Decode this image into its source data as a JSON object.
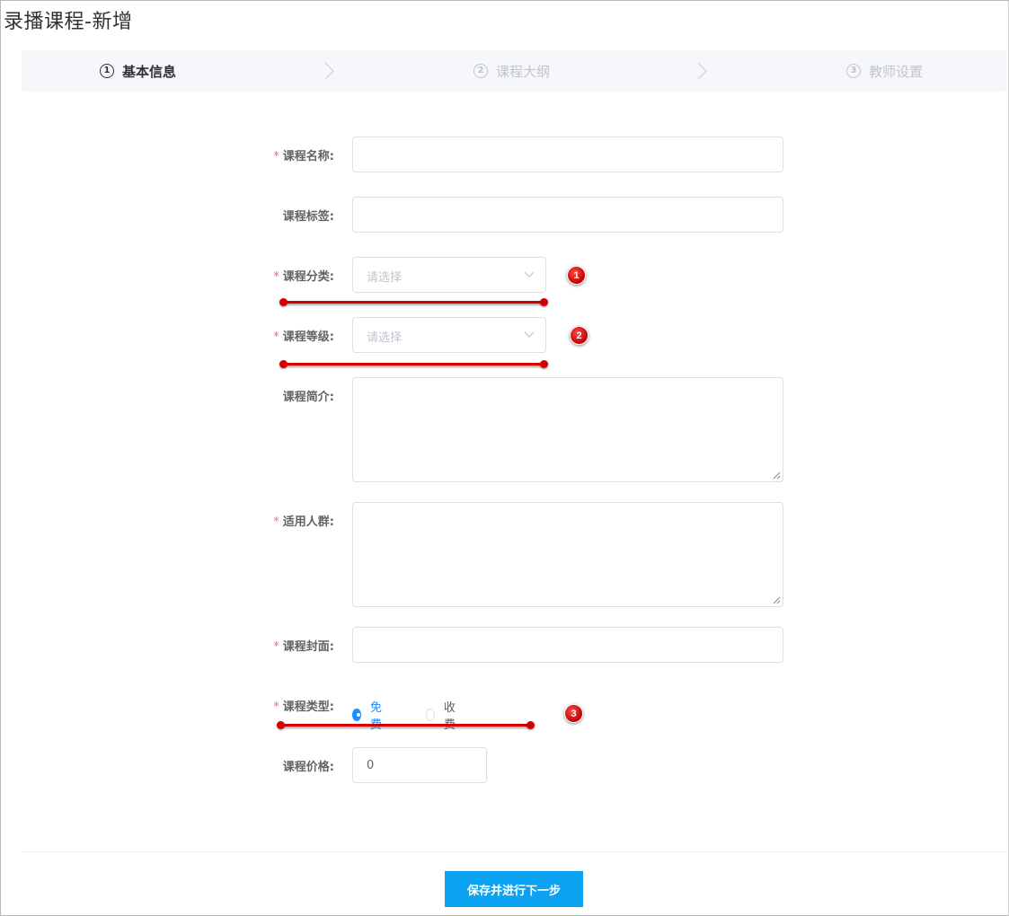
{
  "page": {
    "title": "录播课程-新增"
  },
  "steps": [
    {
      "num": "1",
      "label": "基本信息",
      "state": "active"
    },
    {
      "num": "2",
      "label": "课程大纲",
      "state": "inactive"
    },
    {
      "num": "3",
      "label": "教师设置",
      "state": "inactive"
    }
  ],
  "form": {
    "course_name": {
      "label": "课程名称:",
      "required": true,
      "value": ""
    },
    "course_tags": {
      "label": "课程标签:",
      "required": false,
      "value": ""
    },
    "course_category": {
      "label": "课程分类:",
      "required": true,
      "placeholder": "请选择"
    },
    "course_level": {
      "label": "课程等级:",
      "required": true,
      "placeholder": "请选择"
    },
    "course_intro": {
      "label": "课程简介:",
      "required": false,
      "value": ""
    },
    "audience": {
      "label": "适用人群:",
      "required": true,
      "value": ""
    },
    "cover": {
      "label": "课程封面:",
      "required": true,
      "value": ""
    },
    "course_type": {
      "label": "课程类型:",
      "required": true,
      "options": [
        "免费",
        "收费"
      ],
      "selected": "免费"
    },
    "price": {
      "label": "课程价格:",
      "required": false,
      "value": "0"
    }
  },
  "annotations": {
    "badge1": "1",
    "badge2": "2",
    "badge3": "3"
  },
  "submit_label": "保存并进行下一步",
  "colors": {
    "primary": "#0ca2f2",
    "radio_checked": "#1890ff",
    "annotation": "#d40000",
    "required": "#f56c6c"
  }
}
